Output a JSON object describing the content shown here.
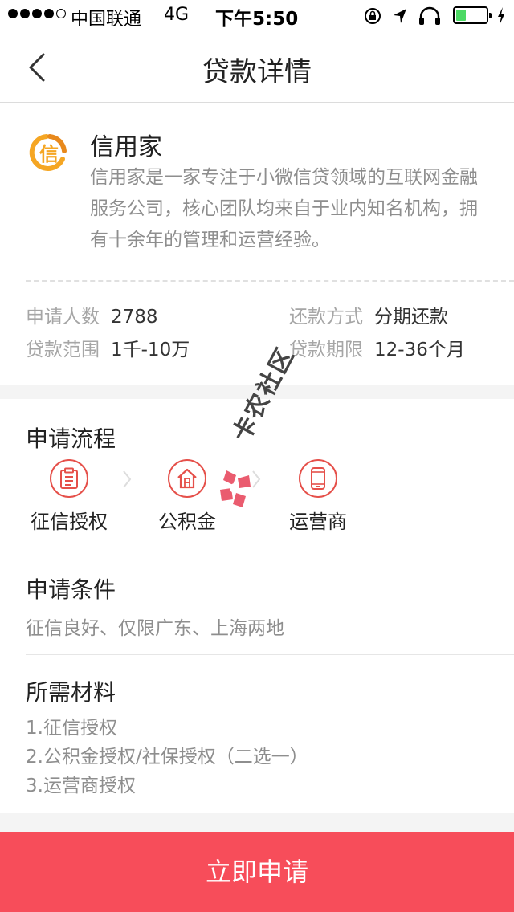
{
  "status_bar": {
    "carrier": "中国联通",
    "network": "4G",
    "time": "下午5:50"
  },
  "nav": {
    "title": "贷款详情"
  },
  "product": {
    "name": "信用家",
    "logo_glyph": "信",
    "description": "信用家是一家专注于小微信贷领域的互联网金融服务公司，核心团队均来自于业内知名机构，拥有十余年的管理和运营经验。",
    "stats": {
      "applicants_label": "申请人数",
      "applicants_value": "2788",
      "repay_label": "还款方式",
      "repay_value": "分期还款",
      "range_label": "贷款范围",
      "range_value": "1千-10万",
      "term_label": "贷款期限",
      "term_value": "12-36个月"
    }
  },
  "process": {
    "title": "申请流程",
    "steps": [
      {
        "label": "征信授权",
        "icon": "clipboard-icon"
      },
      {
        "label": "公积金",
        "icon": "house-icon"
      },
      {
        "label": "运营商",
        "icon": "phone-icon"
      }
    ]
  },
  "conditions": {
    "title": "申请条件",
    "text": "征信良好、仅限广东、上海两地"
  },
  "materials": {
    "title": "所需材料",
    "items": [
      "1.征信授权",
      "2.公积金授权/社保授权（二选一）",
      "3.运营商授权"
    ]
  },
  "apply_button": {
    "label": "立即申请"
  },
  "watermark": {
    "text": "卡农社区"
  },
  "colors": {
    "accent": "#f74d5a",
    "icon_red": "#e5504a",
    "logo_orange": "#f5a623",
    "battery_green": "#4cd964"
  }
}
